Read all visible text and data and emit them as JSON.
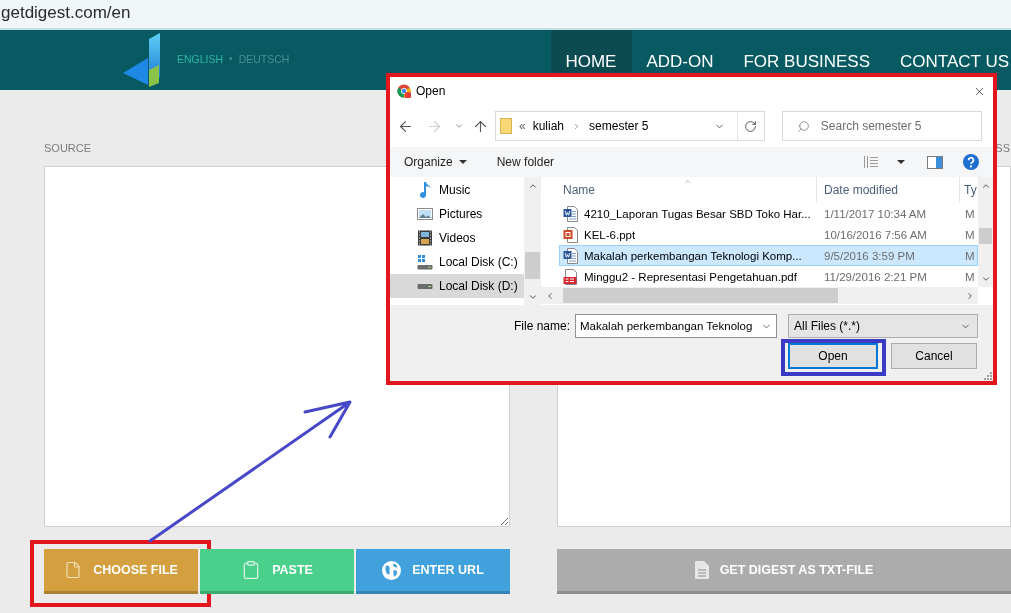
{
  "browser": {
    "url": "getdigest.com/en"
  },
  "header": {
    "languages": [
      {
        "label": "ENGLISH",
        "selected": true
      },
      {
        "label": "DEUTSCH",
        "selected": false
      }
    ],
    "language_separator": "•",
    "nav": [
      {
        "label": "HOME",
        "selected": true
      },
      {
        "label": "ADD-ON",
        "selected": false
      },
      {
        "label": "FOR BUSINESS",
        "selected": false
      },
      {
        "label": "CONTACT US",
        "selected": false
      }
    ]
  },
  "source": {
    "label": "SOURCE"
  },
  "digest": {
    "label": "SS"
  },
  "actions": [
    {
      "label": "CHOOSE FILE",
      "kind": "file",
      "color": "#d49f3f",
      "highlighted": true
    },
    {
      "label": "PASTE",
      "kind": "paste",
      "color": "#4bd08b",
      "highlighted": false
    },
    {
      "label": "ENTER URL",
      "kind": "url",
      "color": "#40a1dd",
      "highlighted": false
    }
  ],
  "digest_button": {
    "label": "GET DIGEST AS TXT-FILE"
  },
  "dialog": {
    "title": "Open",
    "highlighted": true,
    "forward_disabled": true,
    "path_overflow": "«",
    "path": [
      "kuliah",
      "semester 5"
    ],
    "search": {
      "placeholder": "Search semester 5"
    },
    "toolbar": [
      {
        "label": "Organize",
        "kind": "menu"
      },
      {
        "label": "New folder",
        "kind": "button"
      }
    ],
    "nav_pane": [
      {
        "label": "Music",
        "kind": "music",
        "selected": false
      },
      {
        "label": "Pictures",
        "kind": "pictures",
        "selected": false
      },
      {
        "label": "Videos",
        "kind": "videos",
        "selected": false
      },
      {
        "label": "Local Disk (C:)",
        "kind": "system_drive",
        "selected": false
      },
      {
        "label": "Local Disk (D:)",
        "kind": "drive",
        "selected": true
      }
    ],
    "columns": [
      {
        "label": "Name",
        "sorted": true
      },
      {
        "label": "Date modified",
        "sorted": false
      },
      {
        "label": "Ty",
        "sorted": false
      }
    ],
    "files": [
      {
        "name": "4210_Laporan Tugas Besar SBD Toko Har...",
        "kind": "word",
        "date": "1/11/2017 10:34 AM",
        "type": "M",
        "selected": false
      },
      {
        "name": "KEL-6.ppt",
        "kind": "powerpoint",
        "date": "10/16/2016 7:56 AM",
        "type": "M",
        "selected": false
      },
      {
        "name": "Makalah perkembangan Teknologi Komp...",
        "kind": "word",
        "date": "9/5/2016 3:59 PM",
        "type": "M",
        "selected": true
      },
      {
        "name": "Minggu2 - Representasi Pengetahuan.pdf",
        "kind": "pdf",
        "date": "11/29/2016 2:21 PM",
        "type": "M",
        "selected": false
      }
    ],
    "file_name": {
      "label": "File name:",
      "value": "Makalah perkembangan Teknolog"
    },
    "file_type": {
      "value": "All Files (*.*)"
    },
    "buttons": [
      {
        "label": "Open",
        "default": true,
        "highlighted": true
      },
      {
        "label": "Cancel",
        "default": false,
        "highlighted": false
      }
    ]
  }
}
